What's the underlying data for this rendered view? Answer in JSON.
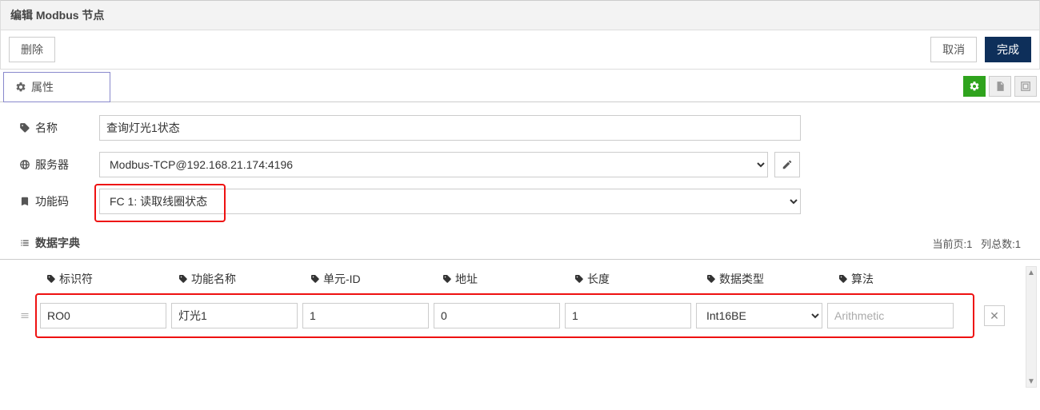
{
  "header": {
    "title": "编辑 Modbus 节点"
  },
  "actions": {
    "delete_label": "删除",
    "cancel_label": "取消",
    "done_label": "完成"
  },
  "tabs": {
    "properties_label": "属性"
  },
  "form": {
    "name": {
      "label": "名称",
      "value": "查询灯光1状态"
    },
    "server": {
      "label": "服务器",
      "selected": "Modbus-TCP@192.168.21.174:4196"
    },
    "function_code": {
      "label": "功能码",
      "selected": "FC 1: 读取线圈状态"
    }
  },
  "dict": {
    "section_label": "数据字典",
    "page_label": "当前页:1",
    "cols_label": "列总数:1",
    "headers": {
      "identifier": "标识符",
      "func_name": "功能名称",
      "unit_id": "单元-ID",
      "address": "地址",
      "length": "长度",
      "data_type": "数据类型",
      "algorithm": "算法"
    },
    "rows": [
      {
        "identifier": "RO0",
        "func_name": "灯光1",
        "unit_id": "1",
        "address": "0",
        "length": "1",
        "data_type": "Int16BE",
        "algorithm": "",
        "algorithm_placeholder": "Arithmetic"
      }
    ]
  }
}
